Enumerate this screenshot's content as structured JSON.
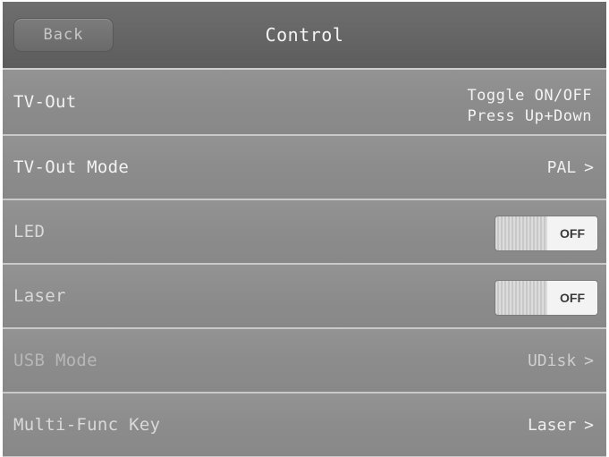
{
  "header": {
    "back_label": "Back",
    "title": "Control"
  },
  "rows": [
    {
      "label": "TV-Out",
      "value_lines": [
        "Toggle ON/OFF",
        "Press Up+Down"
      ]
    },
    {
      "label": "TV-Out Mode",
      "value": "PAL",
      "chevron": ">"
    },
    {
      "label": "LED",
      "toggle_state": "OFF"
    },
    {
      "label": "Laser",
      "toggle_state": "OFF"
    },
    {
      "label": "USB Mode",
      "value": "UDisk",
      "chevron": ">"
    },
    {
      "label": "Multi-Func Key",
      "value": "Laser",
      "chevron": ">"
    }
  ],
  "colors": {
    "header_bg": "#646464",
    "row_bg": "#8c8c8c",
    "divider": "#c9c9c9",
    "toggle_off_bg": "#f3f3f3"
  }
}
